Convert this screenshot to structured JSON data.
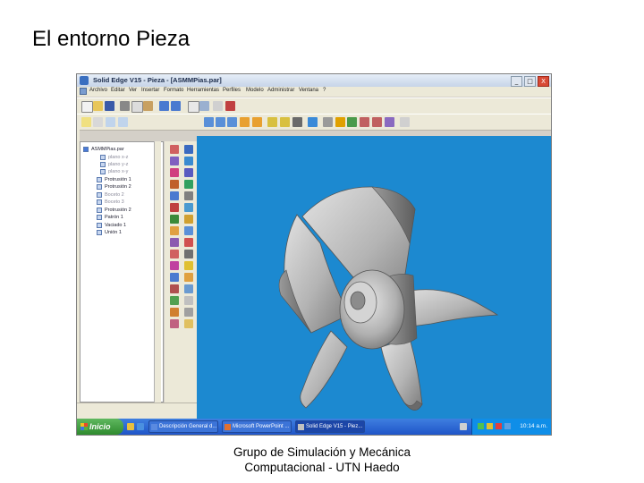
{
  "slide": {
    "title": "El entorno Pieza",
    "footer_line1": "Grupo de Simulación y Mecánica",
    "footer_line2": "Computacional - UTN Haedo"
  },
  "window": {
    "title": "Solid Edge V15 - Pieza - [ASMMPias.par]",
    "buttons": [
      "_",
      "□",
      "X"
    ]
  },
  "menu": {
    "items": [
      "Archivo",
      "Editar",
      "Ver",
      "Insertar",
      "Formato",
      "Herramientas",
      "Perfiles",
      "Modelo",
      "Administrar",
      "Ventana",
      "?"
    ]
  },
  "tree": {
    "items": [
      {
        "label": "ASMMPias.par",
        "dim": false,
        "root": true
      },
      {
        "label": "plano x-z",
        "dim": true
      },
      {
        "label": "plano y-z",
        "dim": true
      },
      {
        "label": "plano x-y",
        "dim": true
      },
      {
        "label": "Protrusión 1",
        "dim": false
      },
      {
        "label": "Protrusión 2",
        "dim": false
      },
      {
        "label": "Boceto 2",
        "dim": true
      },
      {
        "label": "Boceto 3",
        "dim": true
      },
      {
        "label": "Protrusión 2",
        "dim": false
      },
      {
        "label": "Patrón 1",
        "dim": false
      },
      {
        "label": "Vaciado 1",
        "dim": false
      },
      {
        "label": "Unión 1",
        "dim": false
      }
    ]
  },
  "taskbar": {
    "start_label": "Inicio",
    "tasks": [
      {
        "label": "Descripción General d...",
        "active": false
      },
      {
        "label": "Microsoft PowerPoint ...",
        "active": false
      },
      {
        "label": "Solid Edge V15 - Piez...",
        "active": true
      }
    ],
    "clock": "10:14 a.m."
  },
  "colors": {
    "viewport_background": "#1c89d0",
    "model_gray": "#b9b9b9"
  }
}
